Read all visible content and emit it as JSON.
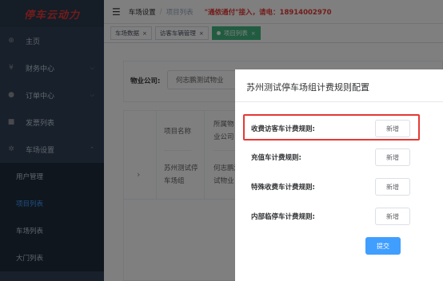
{
  "logo": {
    "text": "停车云动力"
  },
  "sidebar": {
    "items": [
      {
        "label": "主页",
        "icon": "dashboard-icon",
        "glyph": "⊕"
      },
      {
        "label": "财务中心",
        "icon": "yen-icon",
        "glyph": "¥"
      },
      {
        "label": "订单中心",
        "icon": "order-icon",
        "glyph": "●"
      },
      {
        "label": "发票列表",
        "icon": "invoice-icon",
        "glyph": "■"
      },
      {
        "label": "车场设置",
        "icon": "gear-icon",
        "glyph": "✲"
      }
    ],
    "sub_items": [
      {
        "label": "用户管理"
      },
      {
        "label": "项目列表"
      },
      {
        "label": "车场列表"
      },
      {
        "label": "大门列表"
      }
    ]
  },
  "header": {
    "breadcrumb_root": "车场设置",
    "breadcrumb_current": "项目列表",
    "notice": "\"通侬通付\"接入，请电：18914002970"
  },
  "tags": [
    {
      "label": "车场数据"
    },
    {
      "label": "访客车辆管理"
    },
    {
      "label": "项目列表"
    }
  ],
  "filter": {
    "label": "物业公司:",
    "value": "何志鹏测试物业"
  },
  "table": {
    "headers": [
      "项目名称",
      "所属物业公司"
    ],
    "row": {
      "expand": "›",
      "project_name": "苏州测试停车场组",
      "company": "何志鹏测试物业"
    }
  },
  "drawer": {
    "title": "苏州测试停车场组计费规则配置",
    "rules": [
      {
        "label": "收费访客车计费规则:",
        "button": "新增"
      },
      {
        "label": "充值车计费规则:",
        "button": "新增"
      },
      {
        "label": "特殊收费车计费规则:",
        "button": "新增"
      },
      {
        "label": "内部临停车计费规则:",
        "button": "新增"
      }
    ],
    "submit": "提交"
  },
  "colors": {
    "sidebar_bg": "#304156",
    "accent": "#409eff",
    "active_tag": "#42b983",
    "highlight": "#e53935"
  }
}
